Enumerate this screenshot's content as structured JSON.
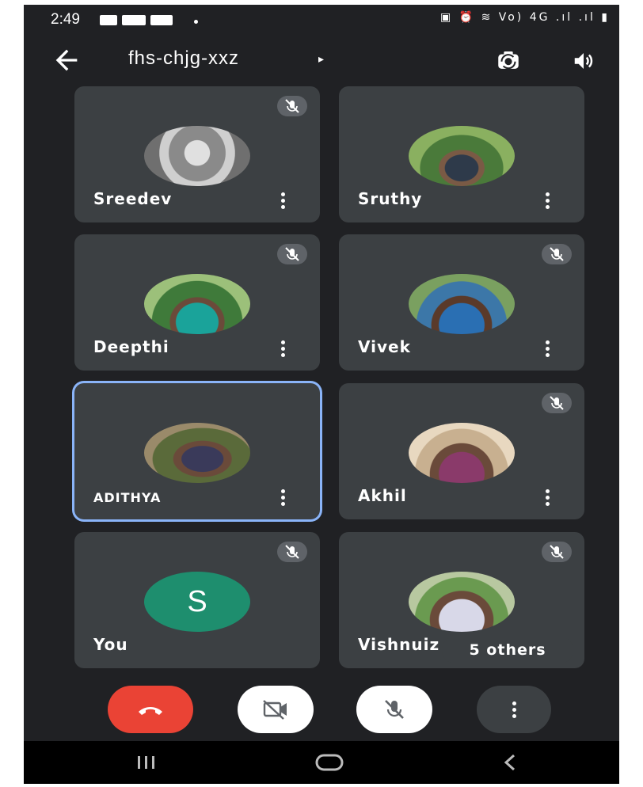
{
  "status_bar": {
    "time": "2:49",
    "right_icons": "▣ ⏰ ≋ Vo) 4G .ıl .ıl ▮"
  },
  "header": {
    "meeting_code": "fhs-chjg-xxz",
    "caret": "▸"
  },
  "participants": [
    {
      "name": "Sreedev",
      "muted": true
    },
    {
      "name": "Sruthy",
      "muted": false
    },
    {
      "name": "Deepthi",
      "muted": true
    },
    {
      "name": "Vivek",
      "muted": true
    },
    {
      "name": "ADITHYA",
      "muted": false,
      "active": true
    },
    {
      "name": "Akhil",
      "muted": true
    },
    {
      "name": "You",
      "muted": true,
      "initial": "S"
    },
    {
      "name": "Vishnuiz",
      "muted": true
    }
  ],
  "others_label": "5 others",
  "colors": {
    "background": "#202124",
    "tile": "#3c4043",
    "active_border": "#8ab4f8",
    "end_call": "#ea4335",
    "avatar_you": "#1e8e6e"
  },
  "controls": [
    "end-call-icon",
    "camera-off-icon",
    "mic-off-icon",
    "more-vert-icon"
  ],
  "nav": [
    "recents-icon",
    "home-icon",
    "back-icon"
  ]
}
